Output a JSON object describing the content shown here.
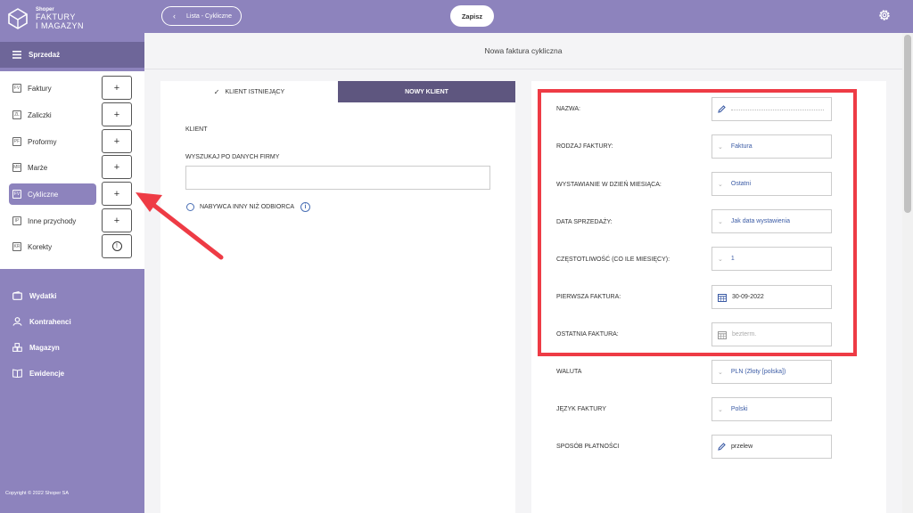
{
  "brand": {
    "small": "Shoper",
    "line1": "FAKTURY",
    "line2": "I MAGAZYN"
  },
  "sidebar": {
    "section_title": "Sprzedaż",
    "sub_items": [
      {
        "label": "Faktury",
        "icon": "FV",
        "action": "+"
      },
      {
        "label": "Zaliczki",
        "icon": "ZL",
        "action": "+"
      },
      {
        "label": "Proformy",
        "icon": "PF",
        "action": "+"
      },
      {
        "label": "Marże",
        "icon": "MR",
        "action": "+"
      },
      {
        "label": "Cykliczne",
        "icon": "FV",
        "action": "+",
        "active": true
      },
      {
        "label": "Inne przychody",
        "icon": "IP",
        "action": "+"
      },
      {
        "label": "Korekty",
        "icon": "KR",
        "action": "!"
      }
    ],
    "nav": [
      {
        "label": "Wydatki",
        "icon": "wallet-icon"
      },
      {
        "label": "Kontrahenci",
        "icon": "person-icon"
      },
      {
        "label": "Magazyn",
        "icon": "boxes-icon"
      },
      {
        "label": "Ewidencje",
        "icon": "book-icon"
      }
    ],
    "copyright": "Copyright © 2022 Shoper SA"
  },
  "topbar": {
    "back_label": "Lista - Cykliczne",
    "save_label": "Zapisz"
  },
  "page_title": "Nowa faktura cykliczna",
  "client": {
    "tab_existing": "KLIENT ISTNIEJĄCY",
    "tab_new": "NOWY KLIENT",
    "section_label": "KLIENT",
    "search_label": "WYSZUKAJ PO DANYCH FIRMY",
    "search_value": "",
    "buyer_option": "NABYWCA INNY NIŻ ODBIORCA"
  },
  "invoice_form": {
    "rows": [
      {
        "label": "NAZWA:",
        "value": "",
        "type": "edit"
      },
      {
        "label": "RODZAJ FAKTURY:",
        "value": "Faktura",
        "type": "select"
      },
      {
        "label": "WYSTAWIANIE W DZIEŃ MIESIĄCA:",
        "value": "Ostatni",
        "type": "select"
      },
      {
        "label": "DATA SPRZEDAŻY:",
        "value": "Jak data wystawienia",
        "type": "select"
      },
      {
        "label": "CZĘSTOTLIWOŚĆ (CO ILE MIESIĘCY):",
        "value": "1",
        "type": "select"
      },
      {
        "label": "PIERWSZA FAKTURA:",
        "value": "30-09-2022",
        "type": "date"
      },
      {
        "label": "OSTATNIA FAKTURA:",
        "value": "",
        "placeholder": "bezterm.",
        "type": "date"
      },
      {
        "label": "WALUTA",
        "value": "PLN (Złoty [polska])",
        "type": "select"
      },
      {
        "label": "JĘZYK FAKTURY",
        "value": "Polski",
        "type": "select"
      },
      {
        "label": "SPOSÓB PŁATNOŚCI",
        "value": "przelew",
        "type": "edit"
      }
    ]
  },
  "colors": {
    "sidebar": "#8d83bd",
    "active_tab": "#5e567f",
    "highlight": "#ee3b45",
    "link": "#3b5ba5"
  }
}
